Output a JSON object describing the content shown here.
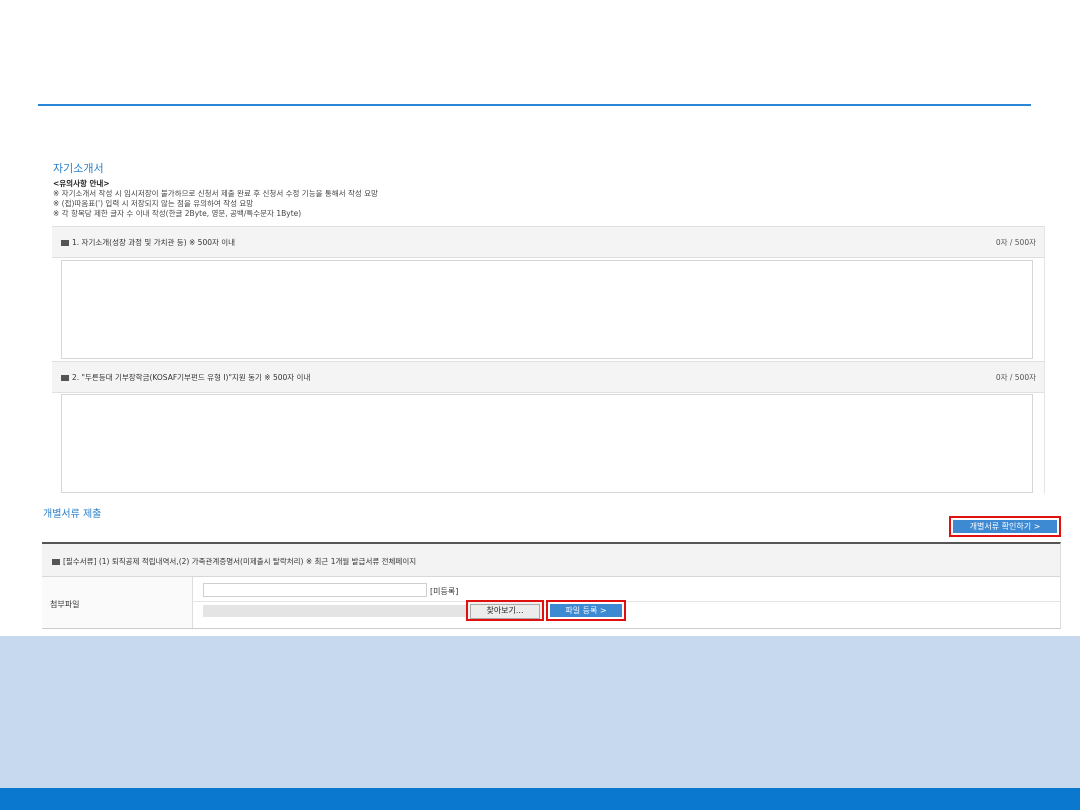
{
  "intro": {
    "title": "자기소개서",
    "notice_heading": "<유의사항 안내>",
    "notices": [
      "※ 자기소개서 작성 시 임시저장이 불가하므로 신청서 제출 완료 후 신청서 수정 기능을 통해서 작성 요망",
      "※ (접)따옴표(') 입력 시 저장되지 않는 점을 유의하여 작성 요망",
      "※ 각 항목당 제한 글자 수 이내 작성(한글 2Byte, 영문, 공백/특수문자 1Byte)"
    ]
  },
  "questions": [
    {
      "label": "1. 자기소개(성장 과정 및 가치관 등) ※ 500자 이내",
      "count": "0자 / 500자"
    },
    {
      "label": "2. \"두른등대 기부장학금(KOSAF기부펀드 유형 I)\"지원 동기 ※ 500자 이내",
      "count": "0자 / 500자"
    }
  ],
  "documents": {
    "title": "개별서류 제출",
    "confirm_button": "개별서류 확인하기 >",
    "required_label": "[필수서류] (1) 퇴직공제 적립내역서,(2) 가족관계증명서(미제출시 탈락처리) ※ 최근 1개월 발급서류 전체페이지",
    "attach_label": "첨부파일",
    "status": "[미등록]",
    "browse_button": "찾아보기...",
    "register_button": "파일 등록 >"
  },
  "colors": {
    "accent": "#2a86d8",
    "button_blue": "#3d8ad3",
    "highlight_red": "#e01010",
    "band": "#c6d9ef",
    "footer": "#0a78cf"
  }
}
